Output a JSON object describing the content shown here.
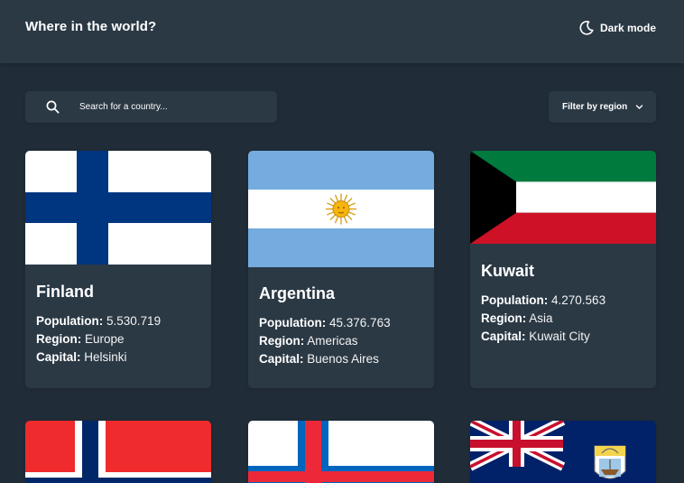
{
  "header": {
    "title": "Where in the world?",
    "theme_toggle_label": "Dark mode"
  },
  "search": {
    "placeholder": "Search for a country...",
    "value": ""
  },
  "filter": {
    "label": "Filter by region"
  },
  "labels": {
    "population": "Population:",
    "region": "Region:",
    "capital": "Capital:"
  },
  "countries": [
    {
      "name": "Finland",
      "population": "5.530.719",
      "region": "Europe",
      "capital": "Helsinki"
    },
    {
      "name": "Argentina",
      "population": "45.376.763",
      "region": "Americas",
      "capital": "Buenos Aires"
    },
    {
      "name": "Kuwait",
      "population": "4.270.563",
      "region": "Asia",
      "capital": "Kuwait City"
    }
  ],
  "colors": {
    "background": "#202c37",
    "element": "#2b3945",
    "text": "#ffffff"
  },
  "icons": {
    "search": "search-icon",
    "theme": "moon-icon",
    "dropdown": "chevron-down-icon"
  }
}
